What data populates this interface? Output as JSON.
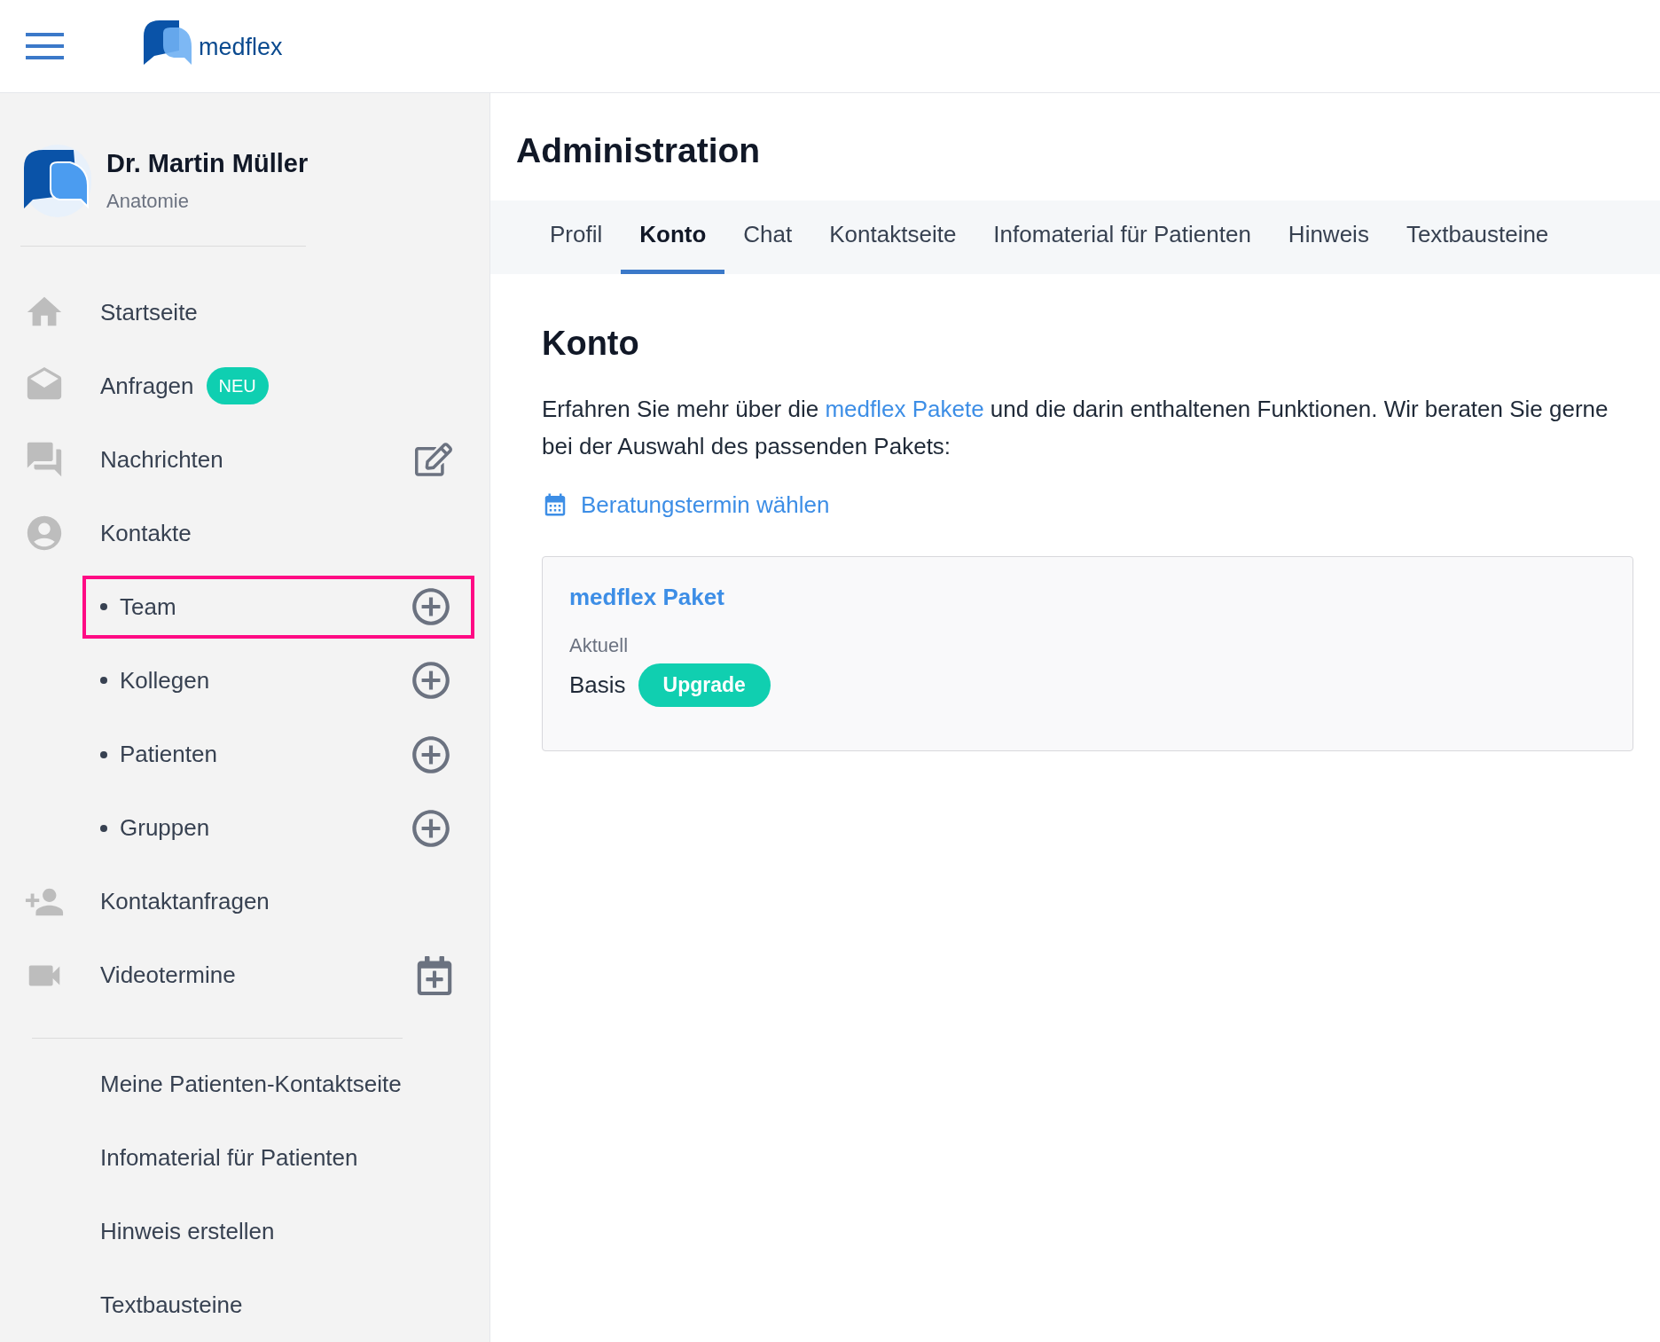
{
  "header": {
    "logo_text": "medflex"
  },
  "profile": {
    "name": "Dr. Martin Müller",
    "subtitle": "Anatomie"
  },
  "nav": {
    "items": [
      {
        "label": "Startseite"
      },
      {
        "label": "Anfragen",
        "badge": "NEU"
      },
      {
        "label": "Nachrichten",
        "kind": "compose"
      },
      {
        "label": "Kontakte",
        "children": [
          {
            "label": "Team",
            "kind": "add",
            "highlighted": true
          },
          {
            "label": "Kollegen",
            "kind": "add",
            "highlighted": false
          },
          {
            "label": "Patienten",
            "kind": "add",
            "highlighted": false
          },
          {
            "label": "Gruppen",
            "kind": "add",
            "highlighted": false
          }
        ]
      },
      {
        "label": "Kontaktanfragen"
      },
      {
        "label": "Videotermine",
        "kind": "schedule"
      }
    ],
    "links": [
      "Meine Patienten-Kontaktseite",
      "Infomaterial für Patienten",
      "Hinweis erstellen",
      "Textbausteine"
    ]
  },
  "page": {
    "title": "Administration",
    "tabs": [
      {
        "label": "Profil",
        "selected": false
      },
      {
        "label": "Konto",
        "selected": true
      },
      {
        "label": "Chat",
        "selected": false
      },
      {
        "label": "Kontaktseite",
        "selected": false
      },
      {
        "label": "Infomaterial für Patienten",
        "selected": false
      },
      {
        "label": "Hinweis",
        "selected": false
      },
      {
        "label": "Textbausteine",
        "selected": false
      }
    ],
    "section": {
      "heading": "Konto",
      "text_before": "Erfahren Sie mehr über die",
      "link": "medflex Pakete",
      "text_after": "und die darin enthaltenen Funktionen. Wir beraten Sie gerne bei der Auswahl des passenden Pakets:",
      "appointment_link": "Beratungstermin wählen",
      "card": {
        "title": "medflex Paket",
        "label": "Aktuell",
        "value": "Basis",
        "button": "Upgrade"
      }
    }
  }
}
